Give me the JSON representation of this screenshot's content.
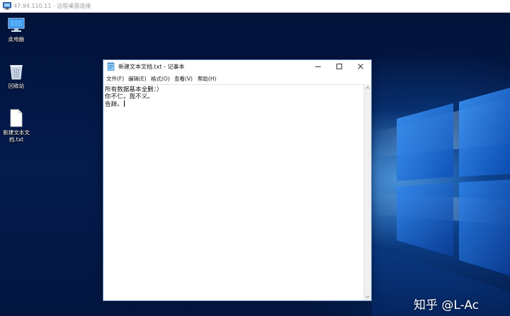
{
  "rdp_window": {
    "title": "47.94.110.11 - 远程桌面连接"
  },
  "desktop": {
    "icons": [
      {
        "label": "此电脑",
        "icon": "this-pc-icon"
      },
      {
        "label": "回收站",
        "icon": "recycle-bin-icon"
      },
      {
        "label": "新建文本文档.txt",
        "label_line1": "新建文本文",
        "label_line2": "档.txt",
        "icon": "text-file-icon"
      }
    ]
  },
  "notepad": {
    "title": "新建文本文档.txt - 记事本",
    "menu": {
      "file": "文件(F)",
      "edit": "编辑(E)",
      "format": "格式(O)",
      "view": "查看(V)",
      "help": "帮助(H)"
    },
    "content": {
      "line1": "所有数据基本全删：）",
      "line2": "你不仁，我不义。",
      "line3": "告辞。"
    }
  },
  "watermark": "知乎 @L-Ac",
  "colors": {
    "desktop_blue": "#0a3d9a",
    "window_border": "#5b84b8",
    "light_beam": "#78c8ff"
  }
}
